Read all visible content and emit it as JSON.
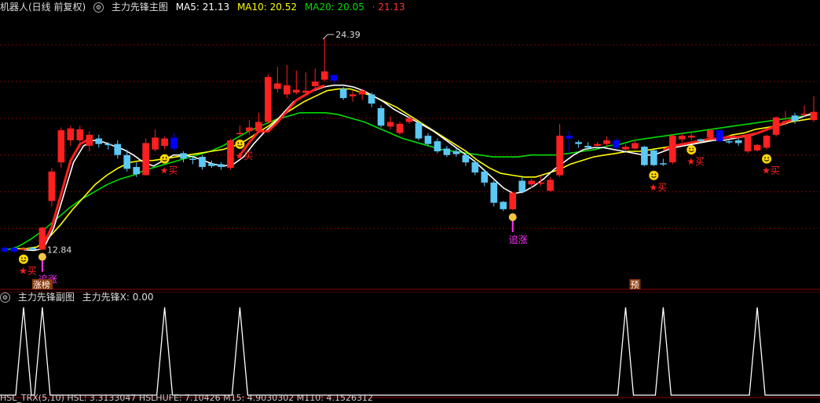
{
  "main_header": {
    "title": "机器人(日线 前复权)",
    "indicator": "主力先锋主图",
    "ma5_label": "MA5: 21.13",
    "ma10_label": "MA10: 20.52",
    "ma20_label": "MA20: 20.05",
    "extra_value": "· 21.13"
  },
  "sub_header": {
    "title": "主力先锋副图",
    "value_label": "主力先锋X: 0.00"
  },
  "bottom_header": {
    "text": "HSL_TRX(5,10) HSL: 3.3133047 HSLHUFE: 7.10426 M15: 4.9030302 M110: 4.1526312"
  },
  "markers": {
    "high_price": "24.39",
    "low_price": "12.84",
    "buy": "★买",
    "chase": "追涨",
    "limit_up": "涨榜",
    "preview": "预"
  },
  "colors": {
    "up": "#ff2020",
    "down": "#5bc8f5",
    "blue": "#0000ff",
    "ma5": "#ffffff",
    "ma10": "#ffff00",
    "ma20": "#00dd00",
    "ma_red": "#ff2020",
    "magenta": "#ff33ff"
  },
  "chart_data": {
    "type": "candlestick",
    "title": "机器人(日线 前复权)",
    "candles": [
      {
        "o": 12.95,
        "c": 12.75,
        "h": 13.0,
        "l": 12.7,
        "col": "blue"
      },
      {
        "o": 12.75,
        "c": 12.95,
        "h": 13.0,
        "l": 12.65,
        "col": "blue"
      },
      {
        "o": 12.9,
        "c": 12.85,
        "h": 13.0,
        "l": 12.84,
        "col": "up"
      },
      {
        "o": 12.95,
        "c": 12.85,
        "h": 13.0,
        "l": 12.84,
        "col": "down"
      },
      {
        "o": 12.85,
        "c": 14.05,
        "h": 14.1,
        "l": 12.84,
        "col": "up"
      },
      {
        "o": 15.5,
        "c": 17.1,
        "h": 17.3,
        "l": 15.2,
        "col": "up"
      },
      {
        "o": 17.6,
        "c": 19.35,
        "h": 19.5,
        "l": 17.3,
        "col": "up"
      },
      {
        "o": 18.8,
        "c": 19.45,
        "h": 19.6,
        "l": 18.5,
        "col": "up"
      },
      {
        "o": 19.4,
        "c": 18.8,
        "h": 19.6,
        "l": 18.4,
        "col": "up"
      },
      {
        "o": 19.1,
        "c": 18.5,
        "h": 19.3,
        "l": 18.2,
        "col": "up"
      },
      {
        "o": 18.9,
        "c": 18.6,
        "h": 19.1,
        "l": 18.4,
        "col": "down"
      },
      {
        "o": 18.6,
        "c": 18.55,
        "h": 18.7,
        "l": 18.3,
        "col": "down"
      },
      {
        "o": 18.6,
        "c": 18.0,
        "h": 18.8,
        "l": 17.8,
        "col": "down"
      },
      {
        "o": 18.0,
        "c": 17.25,
        "h": 18.3,
        "l": 17.1,
        "col": "down"
      },
      {
        "o": 17.35,
        "c": 16.95,
        "h": 17.6,
        "l": 16.8,
        "col": "down"
      },
      {
        "o": 16.9,
        "c": 18.65,
        "h": 18.9,
        "l": 16.9,
        "col": "up"
      },
      {
        "o": 18.3,
        "c": 18.95,
        "h": 19.4,
        "l": 18.2,
        "col": "up"
      },
      {
        "o": 18.9,
        "c": 18.5,
        "h": 19.0,
        "l": 18.3,
        "col": "up"
      },
      {
        "o": 18.95,
        "c": 18.35,
        "h": 19.2,
        "l": 18.2,
        "col": "blue"
      },
      {
        "o": 18.1,
        "c": 17.8,
        "h": 18.2,
        "l": 17.6,
        "col": "down"
      },
      {
        "o": 17.8,
        "c": 17.75,
        "h": 17.9,
        "l": 17.5,
        "col": "down"
      },
      {
        "o": 17.9,
        "c": 17.35,
        "h": 18.0,
        "l": 17.2,
        "col": "down"
      },
      {
        "o": 17.55,
        "c": 17.4,
        "h": 17.7,
        "l": 17.3,
        "col": "down"
      },
      {
        "o": 17.5,
        "c": 17.35,
        "h": 17.6,
        "l": 17.2,
        "col": "down"
      },
      {
        "o": 17.3,
        "c": 18.8,
        "h": 18.9,
        "l": 17.2,
        "col": "up"
      },
      {
        "o": 19.2,
        "c": 19.15,
        "h": 19.6,
        "l": 19.1,
        "col": "up"
      },
      {
        "o": 19.3,
        "c": 19.5,
        "h": 19.9,
        "l": 19.1,
        "col": "up"
      },
      {
        "o": 19.3,
        "c": 19.8,
        "h": 20.3,
        "l": 19.2,
        "col": "up"
      },
      {
        "o": 19.8,
        "c": 22.25,
        "h": 22.4,
        "l": 19.7,
        "col": "up"
      },
      {
        "o": 21.6,
        "c": 21.9,
        "h": 22.8,
        "l": 21.4,
        "col": "up"
      },
      {
        "o": 21.8,
        "c": 21.3,
        "h": 22.9,
        "l": 21.1,
        "col": "up"
      },
      {
        "o": 21.4,
        "c": 21.55,
        "h": 22.6,
        "l": 21.3,
        "col": "up"
      },
      {
        "o": 21.5,
        "c": 21.4,
        "h": 22.5,
        "l": 21.3,
        "col": "up"
      },
      {
        "o": 22.0,
        "c": 21.75,
        "h": 22.7,
        "l": 21.6,
        "col": "up"
      },
      {
        "o": 22.1,
        "c": 22.55,
        "h": 24.39,
        "l": 22.0,
        "col": "up"
      },
      {
        "o": 22.35,
        "c": 22.05,
        "h": 22.4,
        "l": 21.9,
        "col": "blue"
      },
      {
        "o": 21.6,
        "c": 21.1,
        "h": 21.7,
        "l": 21.0,
        "col": "down"
      },
      {
        "o": 21.2,
        "c": 21.3,
        "h": 21.5,
        "l": 20.9,
        "col": "up"
      },
      {
        "o": 21.5,
        "c": 21.3,
        "h": 21.6,
        "l": 21.0,
        "col": "up"
      },
      {
        "o": 21.3,
        "c": 20.8,
        "h": 21.4,
        "l": 20.6,
        "col": "down"
      },
      {
        "o": 20.55,
        "c": 19.6,
        "h": 20.7,
        "l": 19.5,
        "col": "down"
      },
      {
        "o": 19.8,
        "c": 19.55,
        "h": 20.1,
        "l": 19.4,
        "col": "up"
      },
      {
        "o": 19.2,
        "c": 19.7,
        "h": 19.8,
        "l": 19.1,
        "col": "up"
      },
      {
        "o": 19.8,
        "c": 20.0,
        "h": 20.1,
        "l": 19.7,
        "col": "up"
      },
      {
        "o": 19.75,
        "c": 18.9,
        "h": 19.8,
        "l": 18.8,
        "col": "down"
      },
      {
        "o": 19.05,
        "c": 18.6,
        "h": 19.2,
        "l": 18.5,
        "col": "down"
      },
      {
        "o": 18.75,
        "c": 18.2,
        "h": 18.9,
        "l": 18.1,
        "col": "down"
      },
      {
        "o": 18.35,
        "c": 18.0,
        "h": 18.5,
        "l": 17.9,
        "col": "down"
      },
      {
        "o": 18.2,
        "c": 18.05,
        "h": 18.4,
        "l": 17.9,
        "col": "down"
      },
      {
        "o": 18.0,
        "c": 17.6,
        "h": 18.1,
        "l": 17.4,
        "col": "down"
      },
      {
        "o": 17.6,
        "c": 17.05,
        "h": 17.7,
        "l": 16.9,
        "col": "down"
      },
      {
        "o": 17.1,
        "c": 16.5,
        "h": 17.2,
        "l": 16.3,
        "col": "down"
      },
      {
        "o": 16.5,
        "c": 15.4,
        "h": 16.6,
        "l": 15.2,
        "col": "down"
      },
      {
        "o": 15.45,
        "c": 15.05,
        "h": 15.5,
        "l": 14.95,
        "col": "down"
      },
      {
        "o": 15.05,
        "c": 15.95,
        "h": 16.0,
        "l": 15.0,
        "col": "up"
      },
      {
        "o": 16.0,
        "c": 16.6,
        "h": 16.8,
        "l": 15.9,
        "col": "down"
      },
      {
        "o": 16.6,
        "c": 16.4,
        "h": 16.7,
        "l": 16.2,
        "col": "up"
      },
      {
        "o": 16.5,
        "c": 16.45,
        "h": 16.9,
        "l": 16.3,
        "col": "up"
      },
      {
        "o": 16.05,
        "c": 16.65,
        "h": 16.8,
        "l": 16.0,
        "col": "up"
      },
      {
        "o": 16.9,
        "c": 19.05,
        "h": 19.7,
        "l": 16.8,
        "col": "up"
      },
      {
        "o": 18.9,
        "c": 19.05,
        "h": 19.3,
        "l": 18.1,
        "col": "blue"
      },
      {
        "o": 18.7,
        "c": 18.6,
        "h": 18.8,
        "l": 18.4,
        "col": "down"
      },
      {
        "o": 18.4,
        "c": 18.5,
        "h": 18.7,
        "l": 18.3,
        "col": "down"
      },
      {
        "o": 18.6,
        "c": 18.5,
        "h": 18.7,
        "l": 18.4,
        "col": "up"
      },
      {
        "o": 18.6,
        "c": 18.8,
        "h": 19.0,
        "l": 18.5,
        "col": "up"
      },
      {
        "o": 18.8,
        "c": 18.4,
        "h": 18.9,
        "l": 18.3,
        "col": "blue"
      },
      {
        "o": 18.45,
        "c": 18.3,
        "h": 18.6,
        "l": 18.2,
        "col": "up"
      },
      {
        "o": 18.65,
        "c": 18.35,
        "h": 18.8,
        "l": 18.3,
        "col": "up"
      },
      {
        "o": 18.45,
        "c": 17.45,
        "h": 18.5,
        "l": 17.4,
        "col": "down"
      },
      {
        "o": 18.25,
        "c": 17.45,
        "h": 18.3,
        "l": 17.4,
        "col": "down"
      },
      {
        "o": 17.55,
        "c": 17.55,
        "h": 17.8,
        "l": 17.4,
        "col": "down"
      },
      {
        "o": 19.05,
        "c": 17.6,
        "h": 19.1,
        "l": 17.5,
        "col": "up"
      },
      {
        "o": 18.85,
        "c": 19.05,
        "h": 19.2,
        "l": 18.7,
        "col": "up"
      },
      {
        "o": 19.05,
        "c": 18.95,
        "h": 19.3,
        "l": 18.8,
        "col": "up"
      },
      {
        "o": 18.75,
        "c": 18.85,
        "h": 18.9,
        "l": 18.7,
        "col": "down"
      },
      {
        "o": 19.35,
        "c": 18.95,
        "h": 19.4,
        "l": 18.9,
        "col": "up"
      },
      {
        "o": 19.35,
        "c": 18.75,
        "h": 19.4,
        "l": 18.7,
        "col": "blue"
      },
      {
        "o": 18.75,
        "c": 18.75,
        "h": 18.8,
        "l": 18.6,
        "col": "down"
      },
      {
        "o": 18.8,
        "c": 18.65,
        "h": 18.9,
        "l": 18.5,
        "col": "down"
      },
      {
        "o": 19.05,
        "c": 18.2,
        "h": 19.1,
        "l": 18.1,
        "col": "up"
      },
      {
        "o": 18.25,
        "c": 18.55,
        "h": 18.6,
        "l": 18.2,
        "col": "up"
      },
      {
        "o": 19.05,
        "c": 18.4,
        "h": 19.1,
        "l": 18.3,
        "col": "up"
      },
      {
        "o": 20.05,
        "c": 19.1,
        "h": 20.1,
        "l": 19.0,
        "col": "up"
      },
      {
        "o": 19.85,
        "c": 19.85,
        "h": 20.4,
        "l": 19.6,
        "col": "up"
      },
      {
        "o": 19.85,
        "c": 20.15,
        "h": 20.3,
        "l": 19.7,
        "col": "down"
      },
      {
        "o": 20.25,
        "c": 20.25,
        "h": 20.7,
        "l": 20.1,
        "col": "up"
      },
      {
        "o": 20.35,
        "c": 19.9,
        "h": 21.2,
        "l": 19.8,
        "col": "up"
      }
    ],
    "ma5_line": [
      12.85,
      12.8,
      12.9,
      14.0,
      15.8,
      17.6,
      18.5,
      18.8,
      18.7,
      18.5,
      18.3,
      18.0,
      17.6,
      17.4,
      17.7,
      18.0,
      18.0,
      17.9,
      17.7,
      17.5,
      17.4,
      17.5,
      17.9,
      18.6,
      19.2,
      19.7,
      20.3,
      20.9,
      21.2,
      21.5,
      21.7,
      21.8,
      21.8,
      21.7,
      21.5,
      21.2,
      20.9,
      20.5,
      20.2,
      19.9,
      19.6,
      19.3,
      18.9,
      18.5,
      18.1,
      17.7,
      17.2,
      16.7,
      16.2,
      15.9,
      16.0,
      16.3,
      16.7,
      17.2,
      17.6,
      18.0,
      18.3,
      18.4,
      18.4,
      18.3,
      18.2,
      18.1,
      18.0,
      18.0,
      18.2,
      18.4,
      18.5,
      18.6,
      18.7,
      18.8,
      18.8,
      18.9,
      19.0,
      19.1,
      19.3,
      19.5,
      19.7,
      19.9,
      20.1,
      20.3
    ],
    "ma10_line": [
      12.9,
      12.9,
      13.0,
      13.5,
      14.2,
      15.0,
      15.7,
      16.4,
      16.9,
      17.3,
      17.6,
      17.7,
      17.7,
      17.8,
      17.9,
      18.0,
      18.1,
      18.2,
      18.3,
      18.5,
      18.8,
      19.2,
      19.6,
      20.1,
      20.5,
      20.9,
      21.2,
      21.5,
      21.6,
      21.6,
      21.4,
      21.2,
      20.9,
      20.6,
      20.2,
      19.8,
      19.4,
      19.0,
      18.6,
      18.2,
      17.7,
      17.3,
      17.0,
      16.9,
      16.8,
      16.8,
      17.0,
      17.2,
      17.5,
      17.7,
      17.9,
      18.0,
      18.1,
      18.2,
      18.2,
      18.3,
      18.4,
      18.5,
      18.6,
      18.7,
      18.8,
      18.9,
      19.1,
      19.2,
      19.4,
      19.5,
      19.6,
      19.8,
      19.9,
      20.0
    ],
    "ma20_line": [
      12.8,
      13.0,
      13.4,
      13.9,
      14.5,
      15.1,
      15.6,
      16.0,
      16.4,
      16.7,
      16.9,
      17.2,
      17.4,
      17.6,
      17.8,
      18.0,
      18.2,
      18.5,
      18.9,
      19.3,
      19.6,
      19.9,
      20.1,
      20.3,
      20.3,
      20.3,
      20.2,
      20.0,
      19.8,
      19.5,
      19.2,
      18.9,
      18.7,
      18.5,
      18.3,
      18.2,
      18.1,
      18.0,
      17.9,
      17.9,
      17.9,
      18.0,
      18.0,
      18.0,
      18.1,
      18.2,
      18.3,
      18.5,
      18.6,
      18.8,
      18.9,
      19.0,
      19.1,
      19.2,
      19.3,
      19.4,
      19.5,
      19.6,
      19.7,
      19.8,
      19.9,
      20.0,
      20.1,
      20.2
    ],
    "red_trend_line": [
      12.8,
      14.0,
      15.5,
      17.0,
      18.5,
      19.0,
      19.2,
      18.6,
      17.5,
      17.5,
      18.8,
      20.0,
      21.0,
      21.5,
      22.2,
      22.6,
      18.2,
      18.5,
      18.8,
      19.0,
      19.2,
      19.3,
      19.4,
      19.6,
      19.8,
      20.0,
      20.2,
      20.5,
      20.8,
      21.1
    ],
    "sub_signal": {
      "value": 0.0,
      "spike_count": 9
    }
  }
}
